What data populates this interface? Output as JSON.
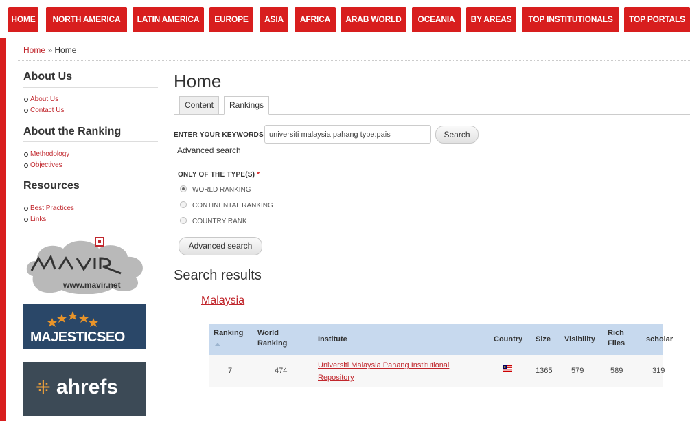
{
  "topnav": {
    "items": [
      "HOME",
      "NORTH AMERICA",
      "LATIN AMERICA",
      "EUROPE",
      "ASIA",
      "AFRICA",
      "ARAB WORLD",
      "OCEANIA",
      "BY AREAS",
      "TOP INSTITUTIONALS",
      "TOP PORTALS"
    ],
    "color": "#d81e1e"
  },
  "breadcrumb": {
    "home": "Home",
    "sep": "»",
    "current": "Home"
  },
  "sidebar": {
    "about_title": "About Us",
    "about_items": [
      "About Us",
      "Contact Us"
    ],
    "ranking_title": "About the Ranking",
    "ranking_items": [
      "Methodology",
      "Objectives"
    ],
    "resources_title": "Resources",
    "resources_items": [
      "Best Practices",
      "Links"
    ],
    "logos": {
      "mavir_text": "www.mavir.net",
      "majestic": "MAJESTICSEO",
      "ahrefs": "ahrefs"
    }
  },
  "main": {
    "title": "Home",
    "tabs": [
      "Content",
      "Rankings"
    ],
    "keyword_label": "ENTER YOUR KEYWORDS",
    "keyword_value": "universiti malaysia pahang type:pais",
    "search_button": "Search",
    "advanced_link": "Advanced search",
    "type_label": "ONLY OF THE TYPE(S)",
    "type_required": "*",
    "types": [
      "WORLD RANKING",
      "CONTINENTAL RANKING",
      "COUNTRY RANK"
    ],
    "selected_type": "WORLD RANKING",
    "advanced_button": "Advanced search",
    "results_title": "Search results",
    "country": "Malaysia"
  },
  "table": {
    "headers": {
      "ranking": "Ranking",
      "world_ranking_1": "World",
      "world_ranking_2": "Ranking",
      "institute": "Institute",
      "country": "Country",
      "size": "Size",
      "visibility": "Visibility",
      "rich_files_1": "Rich",
      "rich_files_2": "Files",
      "scholar": "scholar"
    },
    "rows": [
      {
        "ranking": "7",
        "world_ranking": "474",
        "institute_1": "Universiti Malaysia Pahang Institutional",
        "institute_2": "Repository",
        "country_flag": "malaysia-flag-icon",
        "size": "1365",
        "visibility": "579",
        "rich_files": "589",
        "scholar": "319"
      }
    ]
  }
}
